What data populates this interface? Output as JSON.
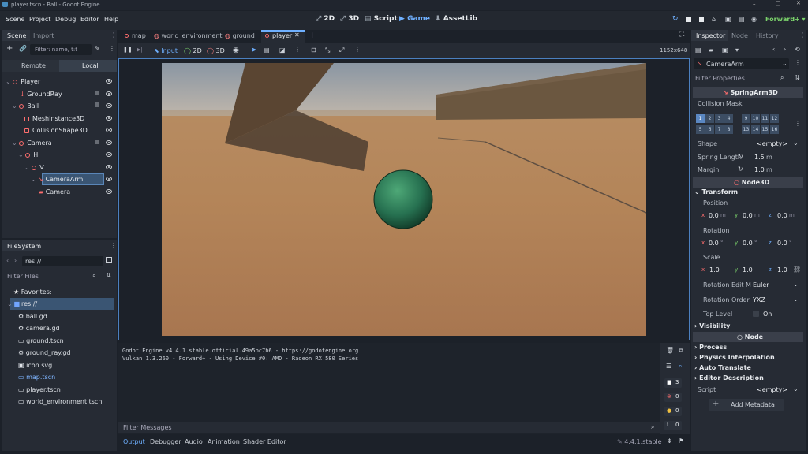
{
  "window": {
    "title": "player.tscn - Ball - Godot Engine"
  },
  "menu": [
    "Scene",
    "Project",
    "Debug",
    "Editor",
    "Help"
  ],
  "workspaces": [
    "2D",
    "3D",
    "Script",
    "Game",
    "AssetLib"
  ],
  "active_workspace": "Game",
  "renderer": "Forward+",
  "scene_dock": {
    "tabs": [
      "Scene",
      "Import"
    ],
    "filter_placeholder": "Filter: name, t:t",
    "remote": "Remote",
    "local": "Local",
    "tree": [
      "Player",
      "GroundRay",
      "Ball",
      "MeshInstance3D",
      "CollisionShape3D",
      "Camera",
      "H",
      "V",
      "CameraArm",
      "Camera"
    ]
  },
  "filesystem": {
    "title": "FileSystem",
    "path": "res://",
    "filter_placeholder": "Filter Files",
    "favorites": "Favorites:",
    "root": "res://",
    "files": [
      "ball.gd",
      "camera.gd",
      "ground.tscn",
      "ground_ray.gd",
      "icon.svg",
      "map.tscn",
      "player.tscn",
      "world_environment.tscn"
    ]
  },
  "scene_tabs": [
    "map",
    "world_environment",
    "ground",
    "player"
  ],
  "game_toolbar": {
    "input": "Input",
    "two_d": "2D",
    "three_d": "3D",
    "resolution": "1152x648"
  },
  "output": {
    "lines": [
      "Godot Engine v4.4.1.stable.official.49a5bc7b6 - https://godotengine.org",
      "Vulkan 1.3.260 - Forward+ - Using Device #0: AMD - Radeon RX 580 Series"
    ],
    "filter_placeholder": "Filter Messages",
    "counts": [
      "3",
      "0",
      "0",
      "0"
    ]
  },
  "bottom_tabs": [
    "Output",
    "Debugger",
    "Audio",
    "Animation",
    "Shader Editor"
  ],
  "version": "4.4.1.stable",
  "inspector": {
    "tabs": [
      "Inspector",
      "Node",
      "History"
    ],
    "node_name": "CameraArm",
    "filter_placeholder": "Filter Properties",
    "class_spring": "SpringArm3D",
    "collision_mask": "Collision Mask",
    "mask_cells": [
      "1",
      "2",
      "3",
      "4",
      "9",
      "10",
      "11",
      "12",
      "5",
      "6",
      "7",
      "8",
      "13",
      "14",
      "15",
      "16"
    ],
    "shape_label": "Shape",
    "shape_value": "<empty>",
    "spring_length_label": "Spring Length",
    "spring_length": "1.5",
    "margin_label": "Margin",
    "margin": "1.0",
    "unit": "m",
    "class_node3d": "Node3D",
    "transform": "Transform",
    "position": "Position",
    "rotation": "Rotation",
    "scale": "Scale",
    "pos": [
      "0.0",
      "0.0",
      "0.0"
    ],
    "rot": [
      "0.0",
      "0.0",
      "0.0"
    ],
    "scl": [
      "1.0",
      "1.0",
      "1.0"
    ],
    "rot_edit_label": "Rotation Edit M",
    "rot_edit": "Euler",
    "rot_order_label": "Rotation Order",
    "rot_order": "YXZ",
    "top_level": "Top Level",
    "top_level_val": "On",
    "visibility": "Visibility",
    "class_node": "Node",
    "process": "Process",
    "physics": "Physics Interpolation",
    "auto_translate": "Auto Translate",
    "editor_desc": "Editor Description",
    "script": "Script",
    "script_val": "<empty>",
    "add_meta": "Add Metadata"
  }
}
